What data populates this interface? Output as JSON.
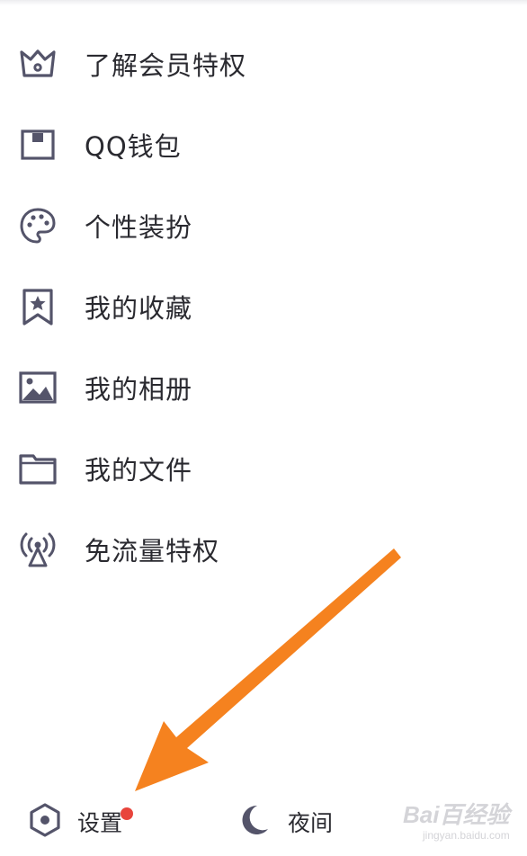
{
  "menu": {
    "items": [
      {
        "label": "了解会员特权",
        "icon": "crown-icon"
      },
      {
        "label": "QQ钱包",
        "icon": "wallet-icon"
      },
      {
        "label": "个性装扮",
        "icon": "palette-icon"
      },
      {
        "label": "我的收藏",
        "icon": "bookmark-star-icon"
      },
      {
        "label": "我的相册",
        "icon": "image-icon"
      },
      {
        "label": "我的文件",
        "icon": "folder-icon"
      },
      {
        "label": "免流量特权",
        "icon": "broadcast-icon"
      }
    ]
  },
  "bottom_bar": {
    "settings_label": "设置",
    "settings_icon": "settings-hexagon-icon",
    "settings_badge": "red-dot",
    "night_label": "夜间",
    "night_icon": "moon-icon"
  },
  "colors": {
    "icon": "#54546a",
    "text": "#2a2a30",
    "badge": "#e8453c",
    "arrow": "#f5821f"
  },
  "watermark": {
    "main": "Bai百经验",
    "sub": "jingyan.baidu.com"
  }
}
